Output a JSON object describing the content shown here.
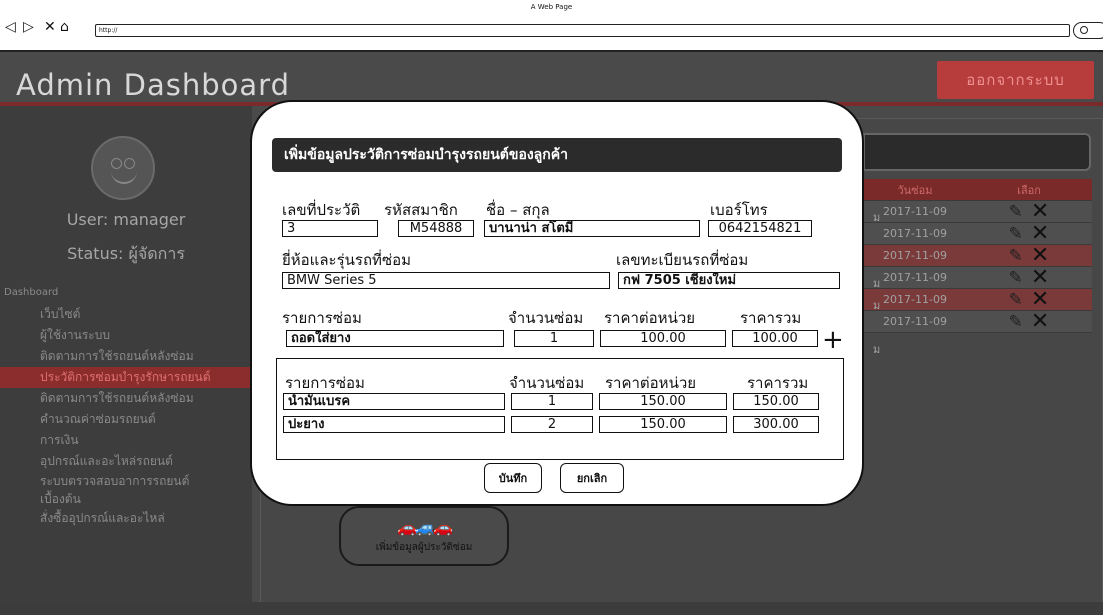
{
  "browser": {
    "title": "A Web Page",
    "url": "http://",
    "nav": [
      "◁",
      "▷",
      "✕",
      "⌂"
    ]
  },
  "app": {
    "title": "Admin Dashboard",
    "logout_label": "ออกจากระบบ"
  },
  "sidebar": {
    "user": "User: manager",
    "status": "Status: ผู้จัดการ",
    "menu_title": "Dashboard",
    "items": [
      {
        "label": "เว็บไซต์"
      },
      {
        "label": "ผู้ใช้งานระบบ"
      },
      {
        "label": "ติดตามการใช้รถยนต์หลังซ่อม"
      },
      {
        "label": "ประวัติการซ่อมบำรุงรักษารถยนต์"
      },
      {
        "label": "ติดตามการใช้รถยนต์หลังซ่อม"
      },
      {
        "label": "คำนวณค่าซ่อมรถยนต์"
      },
      {
        "label": "การเงิน"
      },
      {
        "label": "อุปกรณ์และอะไหล่รถยนต์"
      },
      {
        "label": "ระบบตรวจสอบอาการรถยนต์"
      },
      {
        "label": "เบื้องต้น"
      },
      {
        "label": "สั่งซื้ออุปกรณ์และอะไหล่"
      }
    ]
  },
  "table": {
    "headers": {
      "date": "วันซ่อม",
      "action": "เลือก"
    },
    "rows": [
      {
        "date": "2017-11-09"
      },
      {
        "date": "2017-11-09"
      },
      {
        "date": "2017-11-09"
      },
      {
        "date": "2017-11-09"
      },
      {
        "date": "2017-11-09"
      },
      {
        "date": "2017-11-09"
      }
    ],
    "edge_texts": [
      "ม",
      "ม",
      "ม",
      "ม"
    ]
  },
  "add_record": {
    "label": "เพิ่มข้อมูลผู้ประวัติซ่อม"
  },
  "modal": {
    "title": "เพิ่มข้อมูลประวัติการซ่อมบำรุงรถยนต์ของลูกค้า",
    "labels": {
      "history_no": "เลขที่ประวัติ",
      "member_id": "รหัสสมาชิก",
      "name": "ชื่อ – สกุล",
      "phone": "เบอร์โทร",
      "brand": "ยี่ห้อและรุ่นรถที่ซ่อม",
      "plate": "เลขทะเบียนรถที่ซ่อม",
      "item": "รายการซ่อม",
      "qty": "จำนวนซ่อม",
      "unit_price": "ราคาต่อหน่วย",
      "total": "ราคารวม"
    },
    "values": {
      "history_no": "3",
      "member_id": "M54888",
      "name": "บานาน่า สโตมี่",
      "phone": "0642154821",
      "brand": "BMW Series 5",
      "plate": "กฟ 7505 เชียงใหม่"
    },
    "entry": {
      "item": "ถอดใส่ยาง",
      "qty": "1",
      "unit_price": "100.00",
      "total": "100.00"
    },
    "list_headers": {
      "item": "รายการซ่อม",
      "qty": "จำนวนซ่อม",
      "unit_price": "ราคาต่อหน่วย",
      "total": "ราคารวม"
    },
    "list_rows": [
      {
        "item": "น้ำมันเบรค",
        "qty": "1",
        "unit_price": "150.00",
        "total": "150.00"
      },
      {
        "item": "ปะยาง",
        "qty": "2",
        "unit_price": "150.00",
        "total": "300.00"
      }
    ],
    "save_label": "บันทึก",
    "cancel_label": "ยกเลิก"
  }
}
